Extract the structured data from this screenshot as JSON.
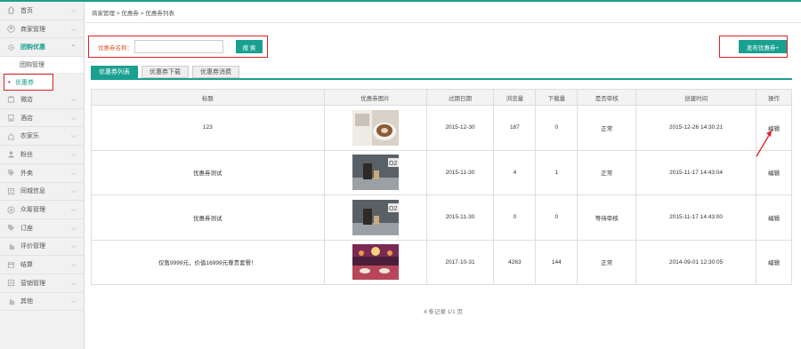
{
  "colors": {
    "accent": "#1aa091",
    "highlight": "#e02020"
  },
  "sidebar": {
    "items": [
      {
        "label": "首页",
        "icon": "home-icon"
      },
      {
        "label": "商家管理",
        "icon": "user-icon"
      },
      {
        "label": "团购优惠",
        "icon": "gear-icon"
      },
      {
        "label": "微店",
        "icon": "shop-icon"
      },
      {
        "label": "酒店",
        "icon": "hotel-icon"
      },
      {
        "label": "农家乐",
        "icon": "farm-icon"
      },
      {
        "label": "粉丝",
        "icon": "fans-icon"
      },
      {
        "label": "外卖",
        "icon": "tag-icon"
      },
      {
        "label": "同城信息",
        "icon": "info-icon"
      },
      {
        "label": "众筹管理",
        "icon": "crowdfund-icon"
      },
      {
        "label": "订座",
        "icon": "seat-icon"
      },
      {
        "label": "评价管理",
        "icon": "review-icon"
      },
      {
        "label": "结算",
        "icon": "settle-icon"
      },
      {
        "label": "营销管理",
        "icon": "marketing-icon"
      },
      {
        "label": "其他",
        "icon": "other-icon"
      }
    ],
    "sub_items": [
      {
        "label": "团购管理"
      },
      {
        "label": "优惠券"
      }
    ]
  },
  "breadcrumb": "商家管理 > 优惠券 > 优惠券列表",
  "search": {
    "label": "优惠券名称：",
    "value": "",
    "button": "搜 索"
  },
  "publish_button": "发布优惠券+",
  "tabs": [
    {
      "label": "优惠券列表"
    },
    {
      "label": "优惠券下载"
    },
    {
      "label": "优惠券消费"
    }
  ],
  "table": {
    "headers": [
      "标题",
      "优惠券图片",
      "过期日期",
      "浏览量",
      "下载量",
      "是否审核",
      "创建时间",
      "操作"
    ],
    "rows": [
      {
        "title": "123",
        "image": "coffee-photo",
        "expire": "2015-12-30",
        "views": "187",
        "downloads": "0",
        "audit": "正常",
        "created": "2015-12-26 14:30:21",
        "op": "编辑"
      },
      {
        "title": "优惠券测试",
        "image": "o2o-ad-photo",
        "expire": "2015-11-30",
        "views": "4",
        "downloads": "1",
        "audit": "正常",
        "created": "2015-11-17 14:43:04",
        "op": "编辑"
      },
      {
        "title": "优惠券测试",
        "image": "o2o-ad-photo",
        "expire": "2015-11-30",
        "views": "0",
        "downloads": "0",
        "audit": "等待审核",
        "created": "2015-11-17 14:43:00",
        "op": "编辑"
      },
      {
        "title": "仅售9999元，价值16999元尊贵套餐！",
        "image": "banquet-hall-photo",
        "expire": "2017-10-31",
        "views": "4263",
        "downloads": "144",
        "audit": "正常",
        "created": "2014-09-01 12:30:05",
        "op": "编辑"
      }
    ]
  },
  "pager": "4 条记录 1/1 页"
}
